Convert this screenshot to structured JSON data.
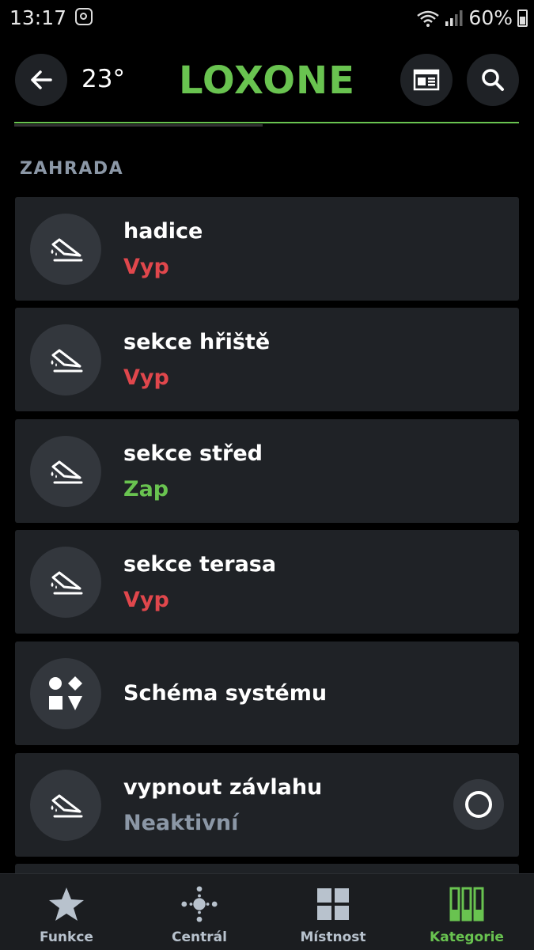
{
  "status_bar": {
    "time": "13:17",
    "battery": "60%"
  },
  "header": {
    "temperature": "23°",
    "logo": "LOXONE"
  },
  "section": {
    "title": "ZAHRADA"
  },
  "colors": {
    "accent": "#69c350",
    "off": "#e0474c",
    "on": "#69c350",
    "inactive": "#8b97a6"
  },
  "items": [
    {
      "name": "hadice",
      "state": "Vyp",
      "icon": "irrigation-icon"
    },
    {
      "name": "sekce hřiště",
      "state": "Vyp",
      "icon": "irrigation-icon"
    },
    {
      "name": "sekce střed",
      "state": "Zap",
      "icon": "irrigation-icon"
    },
    {
      "name": "sekce terasa",
      "state": "Vyp",
      "icon": "irrigation-icon"
    },
    {
      "name": "Schéma systému",
      "icon": "shapes-icon"
    },
    {
      "name": "vypnout závlahu",
      "state": "Neaktivní",
      "icon": "irrigation-icon"
    }
  ],
  "tabs": [
    {
      "label": "Funkce",
      "icon": "star-icon"
    },
    {
      "label": "Centrál",
      "icon": "central-icon"
    },
    {
      "label": "Místnost",
      "icon": "rooms-icon"
    },
    {
      "label": "Kategorie",
      "icon": "categories-icon",
      "active": true
    }
  ]
}
